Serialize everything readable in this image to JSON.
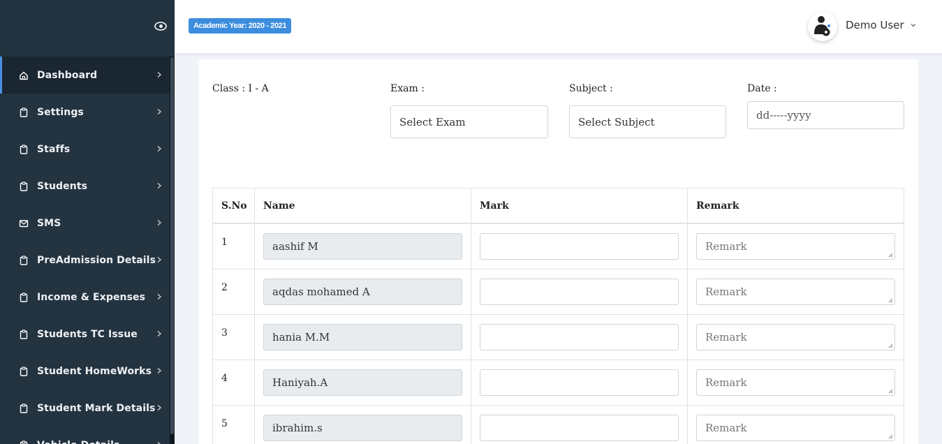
{
  "header": {
    "academic_year": "Academic Year: 2020 - 2021",
    "user_name": "Demo User"
  },
  "sidebar": {
    "items": [
      {
        "label": "Dashboard",
        "icon": "home-icon",
        "active": true
      },
      {
        "label": "Settings",
        "icon": "clipboard-icon"
      },
      {
        "label": "Staffs",
        "icon": "clipboard-icon"
      },
      {
        "label": "Students",
        "icon": "clipboard-icon"
      },
      {
        "label": "SMS",
        "icon": "mail-icon"
      },
      {
        "label": "PreAdmission Details",
        "icon": "clipboard-icon"
      },
      {
        "label": "Income & Expenses",
        "icon": "clipboard-icon"
      },
      {
        "label": "Students TC Issue",
        "icon": "clipboard-icon"
      },
      {
        "label": "Student HomeWorks",
        "icon": "clipboard-icon"
      },
      {
        "label": "Student Mark Details",
        "icon": "clipboard-icon"
      },
      {
        "label": "Vehicle Details",
        "icon": "clipboard-icon"
      }
    ]
  },
  "form": {
    "class_label": "Class : I - A",
    "exam_label": "Exam :",
    "exam_value": "Select Exam",
    "subject_label": "Subject :",
    "subject_value": "Select Subject",
    "date_label": "Date :",
    "date_placeholder": "dd-----yyyy"
  },
  "table": {
    "columns": [
      "S.No",
      "Name",
      "Mark",
      "Remark"
    ],
    "remark_placeholder": "Remark",
    "rows": [
      {
        "sno": "1",
        "name": "aashif  M"
      },
      {
        "sno": "2",
        "name": "aqdas mohamed  A"
      },
      {
        "sno": "3",
        "name": "hania  M.M"
      },
      {
        "sno": "4",
        "name": "Haniyah.A"
      },
      {
        "sno": "5",
        "name": "ibrahim.s"
      }
    ]
  },
  "colors": {
    "sidebar_bg": "#233340",
    "badge_bg": "#3c8dde",
    "active_indicator": "#4a90e2"
  }
}
